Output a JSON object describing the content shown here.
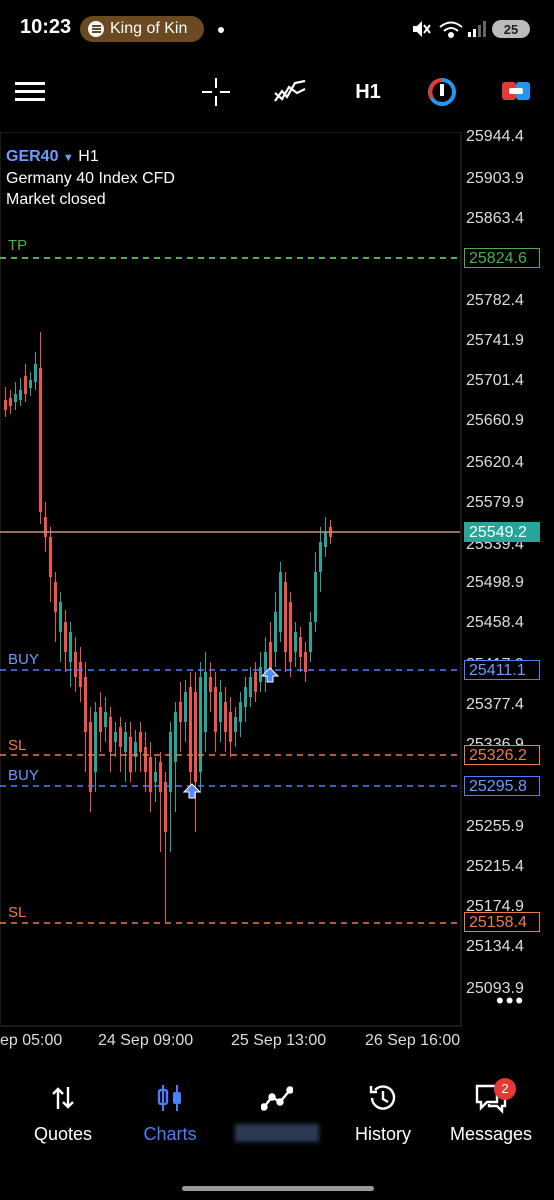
{
  "status_bar": {
    "time": "10:23",
    "now_playing": "King of Kin",
    "battery": "25"
  },
  "toolbar": {
    "timeframe": "H1"
  },
  "symbol": {
    "name": "GER40",
    "timeframe": "H1",
    "description": "Germany 40 Index CFD",
    "status": "Market closed"
  },
  "price_axis": [
    "25944.4",
    "25903.9",
    "25863.4",
    "25782.4",
    "25741.9",
    "25701.4",
    "25660.9",
    "25620.4",
    "25579.9",
    "25539.4",
    "25498.9",
    "25458.4",
    "25417.9",
    "25377.4",
    "25336.9",
    "25255.9",
    "25215.4",
    "25174.9",
    "25134.4",
    "25093.9"
  ],
  "lines": {
    "tp": {
      "label": "TP",
      "price": "25824.6",
      "color": "#4caf50"
    },
    "current": {
      "price": "25549.2",
      "color": "#26a69a"
    },
    "buy1": {
      "label": "BUY",
      "price": "25411.1",
      "color": "#4d7fff"
    },
    "sl1": {
      "label": "SL",
      "price": "25326.2",
      "color": "#ef7b45"
    },
    "buy2": {
      "label": "BUY",
      "price": "25295.8",
      "color": "#4d7fff"
    },
    "sl2": {
      "label": "SL",
      "price": "25158.4",
      "color": "#ef7b45"
    }
  },
  "time_axis": [
    "ep 05:00",
    "24 Sep 09:00",
    "25 Sep 13:00",
    "26 Sep 16:00"
  ],
  "nav": {
    "quotes": "Quotes",
    "charts": "Charts",
    "history": "History",
    "messages": "Messages",
    "messages_badge": "2"
  },
  "colors": {
    "accent": "#4a7dff",
    "bull": "#26a69a",
    "bear": "#ef5350",
    "background": "#000000"
  }
}
